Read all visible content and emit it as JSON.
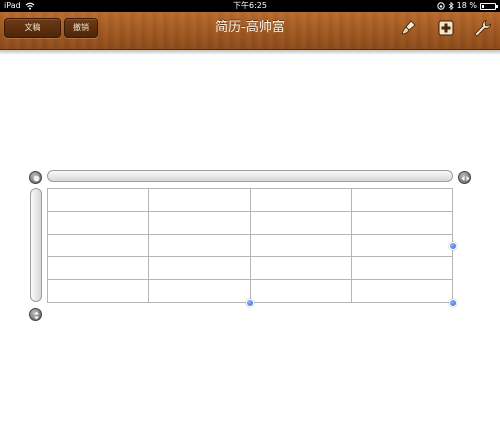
{
  "status_bar": {
    "device": "iPad",
    "time": "下午6:25",
    "battery_text": "18 %",
    "battery_level": 0.18
  },
  "toolbar": {
    "documents_label": "文稿",
    "undo_label": "撤销",
    "title": "简历-高帅富",
    "icons": [
      "brush-icon",
      "insert-icon",
      "wrench-icon"
    ]
  },
  "table": {
    "rows": 5,
    "columns": 4,
    "cells": [
      [
        "",
        "",
        "",
        ""
      ],
      [
        "",
        "",
        "",
        ""
      ],
      [
        "",
        "",
        "",
        ""
      ],
      [
        "",
        "",
        "",
        ""
      ],
      [
        "",
        "",
        "",
        ""
      ]
    ]
  },
  "colors": {
    "toolbar_wood": "#a35a22",
    "selection_dot": "#2b5fd6",
    "grid_line": "#b5b5b5"
  }
}
